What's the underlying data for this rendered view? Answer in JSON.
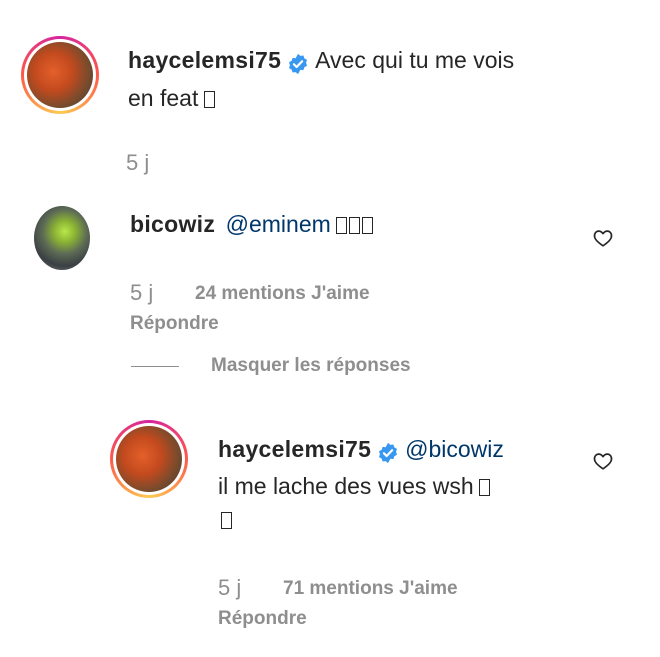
{
  "comment_main": {
    "username": "haycelemsi75",
    "text_line1": "Avec qui tu me vois",
    "text_line2": "en feat",
    "time": "5 j"
  },
  "reply_1": {
    "username": "bicowiz",
    "mention": "@eminem",
    "time": "5 j",
    "likes": "24 mentions J'aime",
    "reply_label": "Répondre"
  },
  "hide_replies": {
    "label": "Masquer les réponses"
  },
  "reply_2": {
    "username": "haycelemsi75",
    "mention": "@bicowiz",
    "text_line1": "il me lache des vues wsh",
    "time": "5 j",
    "likes": "71 mentions J'aime",
    "reply_label": "Répondre"
  },
  "icons": {
    "verified": "verified-badge-icon",
    "like": "heart-outline-icon"
  },
  "colors": {
    "verified": "#3897f0",
    "mention": "#00376b",
    "meta": "#8e8e8e"
  }
}
